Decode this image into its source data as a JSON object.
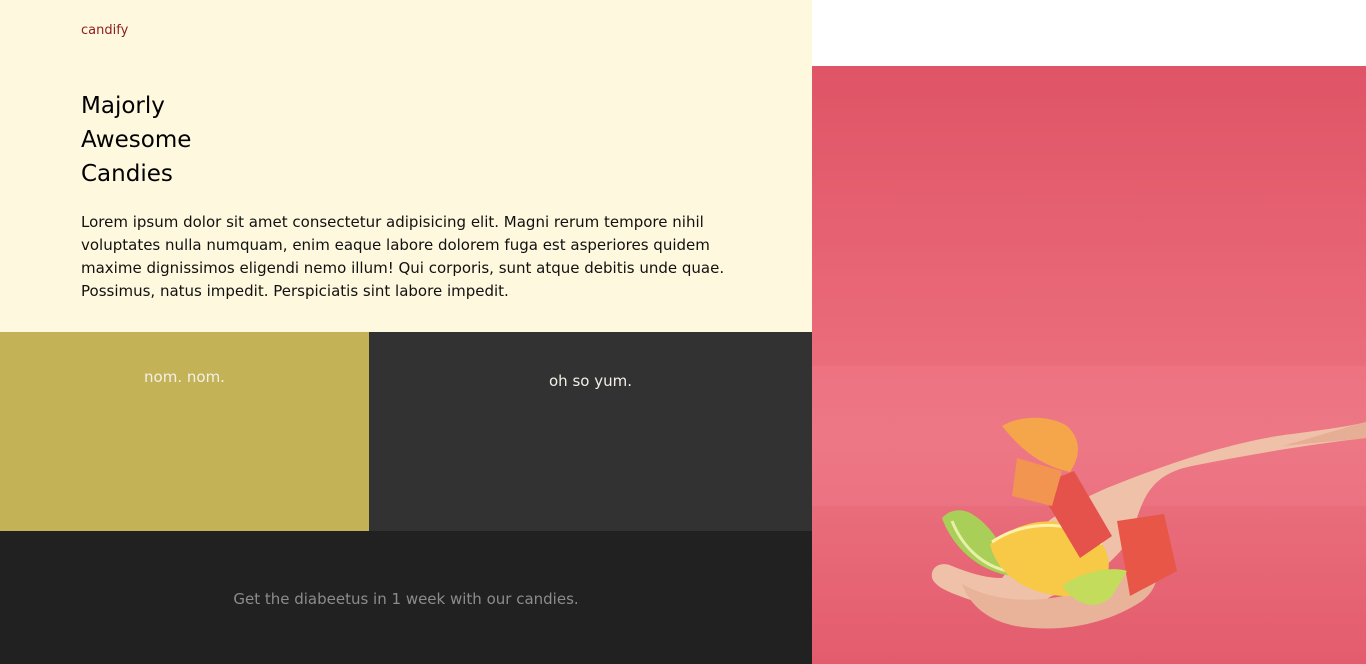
{
  "brand": "candify",
  "hero": {
    "title_lines": [
      "Majorly",
      "Awesome",
      "Candies"
    ],
    "description": "Lorem ipsum dolor sit amet consectetur adipisicing elit. Magni rerum tempore nihil voluptates nulla numquam, enim eaque labore dolorem fuga est asperiores quidem maxime dignissimos eligendi nemo illum! Qui corporis, sunt atque debitis unde quae. Possimus, natus impedit. Perspiciatis sint labore impedit."
  },
  "tiles": {
    "left_text": "nom. nom.",
    "right_text": "oh so yum."
  },
  "footer": {
    "text": "Get the diabeetus in 1 week with our candies."
  },
  "colors": {
    "hero_bg": "#fef8de",
    "brand": "#8b1e1e",
    "tile_left": "#c4b257",
    "tile_right": "#323232",
    "footer": "#212121",
    "photo_bg": "#e8606f"
  }
}
